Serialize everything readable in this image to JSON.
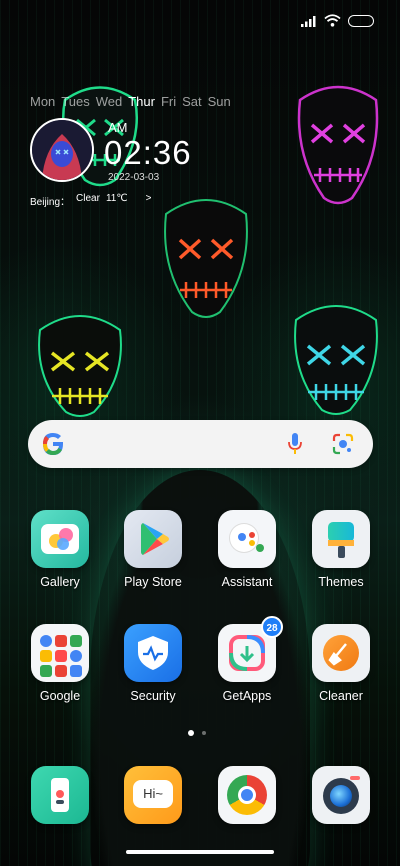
{
  "status_bar": {
    "signal_icon": "signal-icon",
    "wifi_icon": "wifi-icon",
    "battery_icon": "battery-icon"
  },
  "widget": {
    "weekdays": [
      {
        "label": "Mon",
        "active": false
      },
      {
        "label": "Tues",
        "active": false
      },
      {
        "label": "Wed",
        "active": false
      },
      {
        "label": "Thur",
        "active": true
      },
      {
        "label": "Fri",
        "active": false
      },
      {
        "label": "Sat",
        "active": false
      },
      {
        "label": "Sun",
        "active": false
      }
    ],
    "ampm": "AM",
    "time": "02:36",
    "date": "2022-03-03",
    "city": "Beijing：",
    "condition": "Clear",
    "temperature": "11℃",
    "arrow": ">"
  },
  "search_bar": {
    "logo_icon": "google-g-icon",
    "mic_icon": "mic-icon",
    "lens_icon": "lens-icon"
  },
  "apps": [
    {
      "label": "Gallery"
    },
    {
      "label": "Play Store"
    },
    {
      "label": "Assistant"
    },
    {
      "label": "Themes"
    },
    {
      "label": "Google"
    },
    {
      "label": "Security"
    },
    {
      "label": "GetApps",
      "badge": "28"
    },
    {
      "label": "Cleaner"
    }
  ],
  "dock": [
    {
      "icon": "phone-app-icon"
    },
    {
      "icon": "messages-icon",
      "text": "Hi~"
    },
    {
      "icon": "chrome-icon"
    },
    {
      "icon": "camera-icon"
    }
  ],
  "page_indicator": {
    "pages": 2,
    "current": 1
  }
}
